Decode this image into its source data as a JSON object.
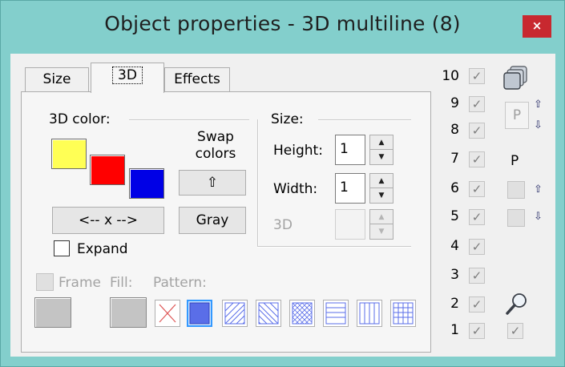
{
  "window": {
    "title": "Object properties - 3D multiline (8)",
    "close_label": "×"
  },
  "tabs": [
    {
      "label": "Size"
    },
    {
      "label": "3D"
    },
    {
      "label": "Effects"
    }
  ],
  "color_section": {
    "label": "3D color:",
    "swap_label_line1": "Swap",
    "swap_label_line2": "colors",
    "swap_button_label": "⇧",
    "swatches": [
      "#ffff55",
      "#ff0000",
      "#0000e6"
    ],
    "swap_arrows_label": "<-- x -->",
    "gray_button_label": "Gray",
    "expand_label": "Expand"
  },
  "size_section": {
    "label": "Size:",
    "height_label": "Height:",
    "height_value": "1",
    "width_label": "Width:",
    "width_value": "1",
    "threed_label": "3D",
    "threed_value": ""
  },
  "fill_section": {
    "frame_label": "Frame",
    "fill_label": "Fill:",
    "pattern_label": "Pattern:",
    "patterns": [
      "none",
      "solid",
      "diagonal-forward",
      "diagonal-back",
      "cross-diagonal",
      "horizontal",
      "vertical",
      "grid"
    ],
    "selected_pattern": "solid"
  },
  "side_panel": {
    "rows": [
      "10",
      "9",
      "8",
      "7",
      "6",
      "5",
      "4",
      "3",
      "2",
      "1"
    ],
    "p_button_label": "P",
    "p_label": "P",
    "icons": [
      "layers-icon",
      "arrow-up-icon",
      "arrow-down-icon",
      "arrow-up-icon",
      "arrow-down-icon",
      "magnifier-icon"
    ]
  }
}
